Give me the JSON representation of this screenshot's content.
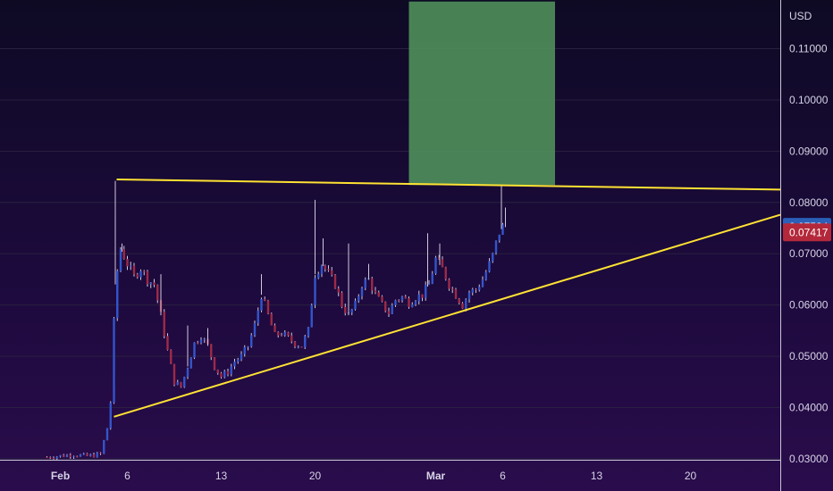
{
  "chart_data": {
    "type": "candlestick",
    "currency_label": "USD",
    "ylim": [
      0.0298,
      0.1195
    ],
    "price_ticks": [
      "0.11000",
      "0.10000",
      "0.09000",
      "0.08000",
      "0.07000",
      "0.06000",
      "0.05000",
      "0.04000",
      "0.03000"
    ],
    "date_ticks": [
      {
        "label": "Feb",
        "day": 1,
        "bold": true
      },
      {
        "label": "6",
        "day": 6,
        "bold": false
      },
      {
        "label": "13",
        "day": 13,
        "bold": false
      },
      {
        "label": "20",
        "day": 20,
        "bold": false
      },
      {
        "label": "Mar",
        "day": 29,
        "bold": true
      },
      {
        "label": "6",
        "day": 34,
        "bold": false
      },
      {
        "label": "13",
        "day": 41,
        "bold": false
      },
      {
        "label": "20",
        "day": 48,
        "bold": false
      }
    ],
    "xlim_days": [
      -3.5,
      54.7
    ],
    "current_price": {
      "label": "0.07524",
      "value": 0.07524,
      "color": "#2b5fb8"
    },
    "prev_close": {
      "label": "0.07417",
      "value": 0.07417,
      "color": "#b3283a"
    },
    "colors": {
      "up": "#3355cc",
      "down": "#9e2a48",
      "wick": "#cfc8dd",
      "trendline": "#ffe233",
      "target_box": "#4f8f5a",
      "axis_line": "#c9c4d6",
      "grid": "#2a2040"
    },
    "resistance_line": {
      "start": {
        "day": 5.2,
        "price": 0.0845
      },
      "end": {
        "day": 54.7,
        "price": 0.0825
      }
    },
    "support_line": {
      "start": {
        "day": 5.0,
        "price": 0.0382
      },
      "end": {
        "day": 54.7,
        "price": 0.0776
      }
    },
    "target_zone": {
      "day_start": 27.0,
      "day_end": 37.9,
      "price_low": 0.0834,
      "price_high": 0.1192
    },
    "price_path": [
      [
        0.0,
        0.0303
      ],
      [
        2.0,
        0.0308
      ],
      [
        3.0,
        0.0305
      ],
      [
        4.0,
        0.0309
      ],
      [
        4.5,
        0.036
      ],
      [
        4.8,
        0.042
      ],
      [
        5.1,
        0.064
      ],
      [
        5.5,
        0.071
      ],
      [
        6.0,
        0.068
      ],
      [
        6.5,
        0.0655
      ],
      [
        7.0,
        0.0672
      ],
      [
        7.5,
        0.065
      ],
      [
        8.0,
        0.064
      ],
      [
        8.5,
        0.058
      ],
      [
        9.0,
        0.051
      ],
      [
        9.5,
        0.045
      ],
      [
        10.0,
        0.044
      ],
      [
        10.5,
        0.048
      ],
      [
        11.0,
        0.0525
      ],
      [
        11.5,
        0.054
      ],
      [
        12.0,
        0.052
      ],
      [
        12.5,
        0.048
      ],
      [
        13.0,
        0.046
      ],
      [
        13.5,
        0.047
      ],
      [
        14.0,
        0.049
      ],
      [
        14.5,
        0.05
      ],
      [
        15.0,
        0.052
      ],
      [
        15.5,
        0.056
      ],
      [
        16.0,
        0.062
      ],
      [
        16.5,
        0.058
      ],
      [
        17.0,
        0.054
      ],
      [
        17.5,
        0.0545
      ],
      [
        18.0,
        0.0535
      ],
      [
        18.5,
        0.0525
      ],
      [
        19.0,
        0.052
      ],
      [
        19.5,
        0.055
      ],
      [
        20.0,
        0.066
      ],
      [
        20.5,
        0.068
      ],
      [
        21.0,
        0.066
      ],
      [
        21.5,
        0.064
      ],
      [
        22.0,
        0.06
      ],
      [
        22.5,
        0.058
      ],
      [
        23.0,
        0.06
      ],
      [
        23.5,
        0.064
      ],
      [
        24.0,
        0.065
      ],
      [
        24.5,
        0.062
      ],
      [
        25.0,
        0.06
      ],
      [
        25.5,
        0.0585
      ],
      [
        26.0,
        0.061
      ],
      [
        26.5,
        0.0615
      ],
      [
        27.0,
        0.0605
      ],
      [
        27.5,
        0.0615
      ],
      [
        28.0,
        0.062
      ],
      [
        28.5,
        0.064
      ],
      [
        29.0,
        0.069
      ],
      [
        29.5,
        0.067
      ],
      [
        30.0,
        0.064
      ],
      [
        30.5,
        0.062
      ],
      [
        31.0,
        0.06
      ],
      [
        31.5,
        0.0625
      ],
      [
        32.0,
        0.063
      ],
      [
        32.5,
        0.065
      ],
      [
        33.0,
        0.068
      ],
      [
        33.3,
        0.07
      ],
      [
        33.7,
        0.074
      ],
      [
        34.0,
        0.0752
      ]
    ],
    "wick_spikes": [
      [
        5.1,
        0.0842
      ],
      [
        5.6,
        0.072
      ],
      [
        8.5,
        0.066
      ],
      [
        10.5,
        0.056
      ],
      [
        12.0,
        0.0555
      ],
      [
        16.0,
        0.066
      ],
      [
        20.0,
        0.0805
      ],
      [
        20.6,
        0.073
      ],
      [
        22.5,
        0.072
      ],
      [
        24.0,
        0.068
      ],
      [
        28.4,
        0.074
      ],
      [
        29.3,
        0.072
      ],
      [
        33.9,
        0.0833
      ],
      [
        34.2,
        0.079
      ]
    ]
  }
}
